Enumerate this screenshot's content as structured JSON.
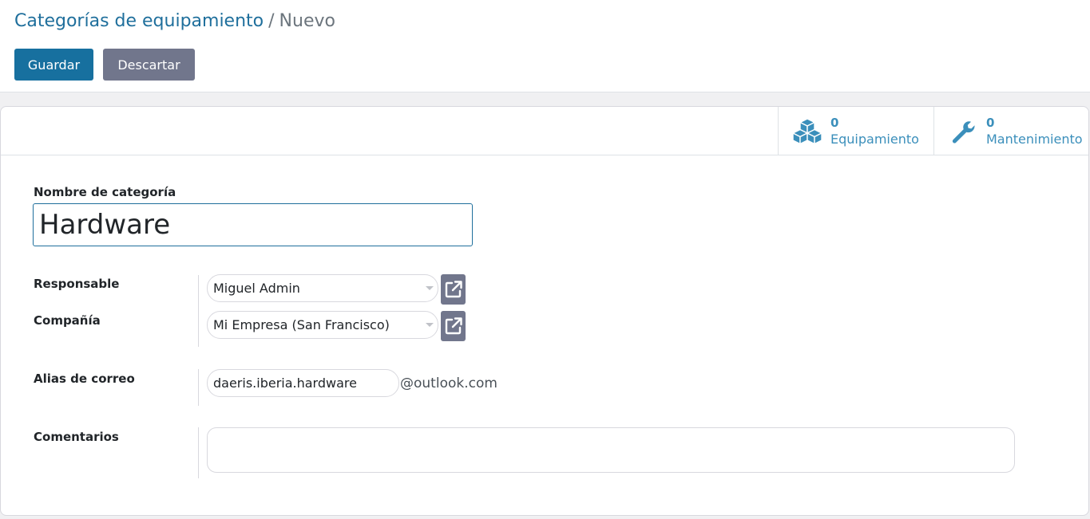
{
  "breadcrumb": {
    "parent": "Categorías de equipamiento",
    "separator": "/",
    "current": "Nuevo"
  },
  "toolbar": {
    "save_label": "Guardar",
    "discard_label": "Descartar"
  },
  "smart_buttons": [
    {
      "icon": "cubes-icon",
      "value": "0",
      "label": "Equipamiento"
    },
    {
      "icon": "wrench-icon",
      "value": "0",
      "label": "Mantenimiento"
    }
  ],
  "form": {
    "name_label": "Nombre de categoría",
    "name_value": "Hardware",
    "responsible_label": "Responsable",
    "responsible_value": "Miguel Admin",
    "company_label": "Compañía",
    "company_value": "Mi Empresa (San Francisco)",
    "alias_label": "Alias de correo",
    "alias_value": "daeris.iberia.hardware",
    "alias_domain": "@outlook.com",
    "comments_label": "Comentarios",
    "comments_value": ""
  },
  "colors": {
    "primary": "#17709f",
    "secondary": "#71768c",
    "link": "#1f6f9c",
    "stat_text": "#3b8fbb"
  }
}
